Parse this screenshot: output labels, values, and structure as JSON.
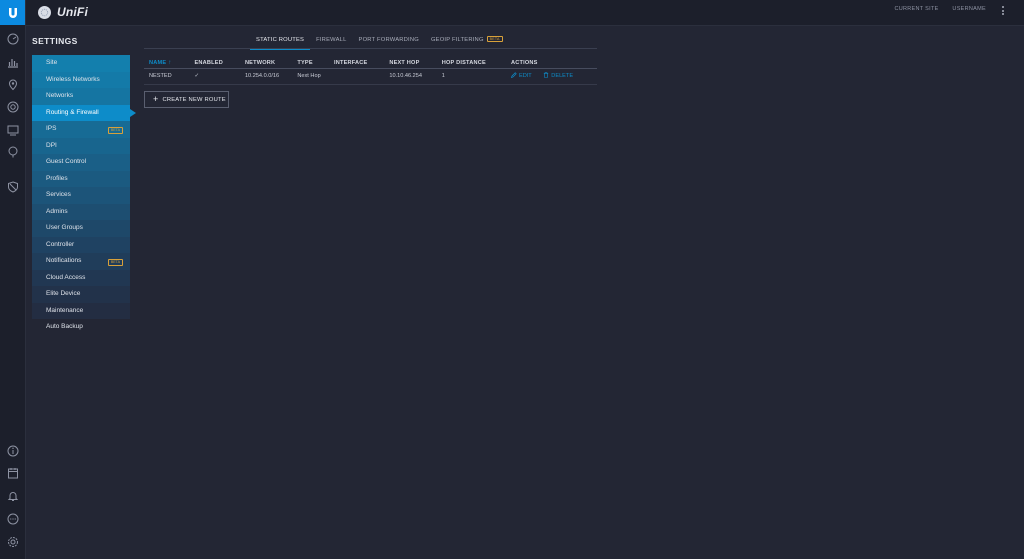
{
  "topbar": {
    "brand": "UniFi",
    "current_site": "CURRENT SITE",
    "username": "USERNAME"
  },
  "settings_title": "SETTINGS",
  "sidebar": {
    "items": [
      {
        "label": "Site"
      },
      {
        "label": "Wireless Networks"
      },
      {
        "label": "Networks"
      },
      {
        "label": "Routing & Firewall"
      },
      {
        "label": "IPS",
        "badge": "BETA"
      },
      {
        "label": "DPI"
      },
      {
        "label": "Guest Control"
      },
      {
        "label": "Profiles"
      },
      {
        "label": "Services"
      },
      {
        "label": "Admins"
      },
      {
        "label": "User Groups"
      },
      {
        "label": "Controller"
      },
      {
        "label": "Notifications",
        "badge": "BETA"
      },
      {
        "label": "Cloud Access"
      },
      {
        "label": "Elite Device"
      },
      {
        "label": "Maintenance"
      },
      {
        "label": "Auto Backup"
      }
    ],
    "active_index": 3
  },
  "tabs": [
    {
      "label": "STATIC ROUTES"
    },
    {
      "label": "FIREWALL"
    },
    {
      "label": "PORT FORWARDING"
    },
    {
      "label": "GEOIP FILTERING",
      "badge": "BETA"
    }
  ],
  "table": {
    "headers": [
      "NAME",
      "ENABLED",
      "NETWORK",
      "TYPE",
      "INTERFACE",
      "NEXT HOP",
      "HOP DISTANCE",
      "ACTIONS"
    ],
    "rows": [
      {
        "name": "NESTED",
        "enabled": "✓",
        "network": "10.254.0.0/16",
        "type": "Next Hop",
        "interface": "",
        "next_hop": "10.10.46.254",
        "hop_distance": "1"
      }
    ],
    "actions": {
      "edit": "EDIT",
      "delete": "DELETE"
    }
  },
  "create_button": "CREATE NEW ROUTE",
  "colors": {
    "accent": "#0d8cc9",
    "background": "#232634",
    "beta": "#d8a13a"
  }
}
